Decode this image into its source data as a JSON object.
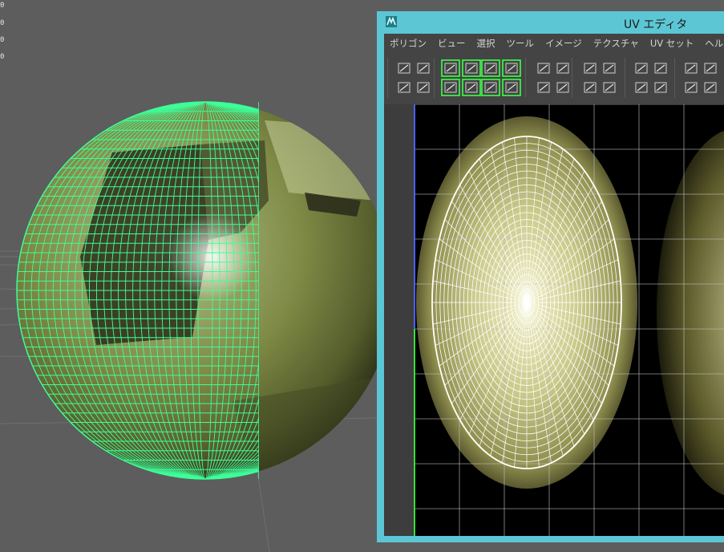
{
  "viewport": {
    "hud_values": [
      "0",
      "0",
      "0",
      "0"
    ],
    "mesh_color": "#3dff9a",
    "sphere_color": "#8f9b52",
    "background_color": "#5d5d5d"
  },
  "uv_editor": {
    "title": "UV エディタ",
    "titlebar_color": "#5cc6d4",
    "menu": [
      {
        "id": "polygon",
        "label": "ポリゴン"
      },
      {
        "id": "view",
        "label": "ビュー"
      },
      {
        "id": "select",
        "label": "選択"
      },
      {
        "id": "tool",
        "label": "ツール"
      },
      {
        "id": "image",
        "label": "イメージ"
      },
      {
        "id": "texture",
        "label": "テクスチャ"
      },
      {
        "id": "uvset",
        "label": "UV セット"
      },
      {
        "id": "help",
        "label": "ヘルプ"
      }
    ],
    "toolbar_icons": [
      "grid-snap-icon",
      "uv-layout-icon",
      "unfold-icon",
      "cut-uv-icon",
      "sew-uv-icon",
      "split-uv-icon",
      "flip-u-icon",
      "flip-v-icon",
      "align-stack-icon",
      "normalize-icon",
      "move-left-icon",
      "move-right-icon",
      "distribute-icon",
      "add-uv-icon",
      "select-border-icon",
      "select-pointer-icon",
      "select-shell-icon",
      "create-uv-icon",
      "smooth-uv-icon",
      "relax-icon",
      "rotate-ccw-icon",
      "rotate-cw-icon",
      "spread-icon",
      "gather-icon",
      "move-down-icon",
      "move-up-icon",
      "snap-icon",
      "stack-icon"
    ],
    "grid_color": "#bdbdbd",
    "uv_wire_color": "#ffffff"
  }
}
